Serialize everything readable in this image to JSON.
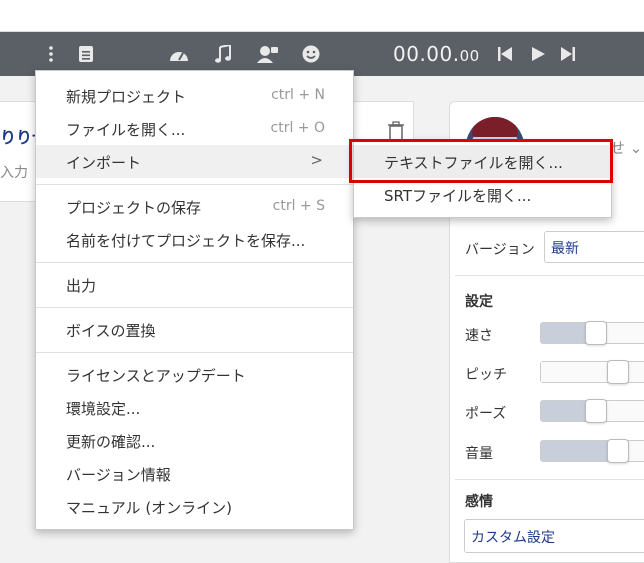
{
  "toolbar": {
    "time_main": "00.00.",
    "time_frac": "00",
    "icons": [
      "more-vertical-icon",
      "document-icon",
      "speedometer-icon",
      "music-note-icon",
      "voice-icon",
      "smiley-icon",
      "skip-back-icon",
      "play-icon",
      "skip-forward-icon"
    ]
  },
  "left_card": {
    "title": "りりせ",
    "placeholder": "入力"
  },
  "right_panel": {
    "name_partial": "せ",
    "version_label": "バージョン",
    "version_value": "最新",
    "settings_head": "設定",
    "sliders": [
      {
        "label": "速さ",
        "value": 0.5
      },
      {
        "label": "ピッチ",
        "value": 0.7
      },
      {
        "label": "ポーズ",
        "value": 0.5
      },
      {
        "label": "音量",
        "value": 0.7
      }
    ],
    "emotion_head": "感情",
    "emotion_value": "カスタム設定"
  },
  "menu": {
    "items": [
      {
        "label": "新規プロジェクト",
        "shortcut": "ctrl + N"
      },
      {
        "label": "ファイルを開く...",
        "shortcut": "ctrl + O"
      },
      {
        "label": "インポート",
        "arrow": ">"
      },
      {
        "label": "プロジェクトの保存",
        "shortcut": "ctrl + S"
      },
      {
        "label": "名前を付けてプロジェクトを保存..."
      },
      {
        "label": "出力"
      },
      {
        "label": "ボイスの置換"
      },
      {
        "label": "ライセンスとアップデート"
      },
      {
        "label": "環境設定..."
      },
      {
        "label": "更新の確認..."
      },
      {
        "label": "バージョン情報"
      },
      {
        "label": "マニュアル (オンライン)"
      }
    ]
  },
  "submenu": {
    "items": [
      {
        "label": "テキストファイルを開く..."
      },
      {
        "label": "SRTファイルを開く..."
      }
    ]
  },
  "colors": {
    "toolbar": "#5b5f66",
    "highlight": "#e00000",
    "accent_text": "#1f3a8a"
  }
}
